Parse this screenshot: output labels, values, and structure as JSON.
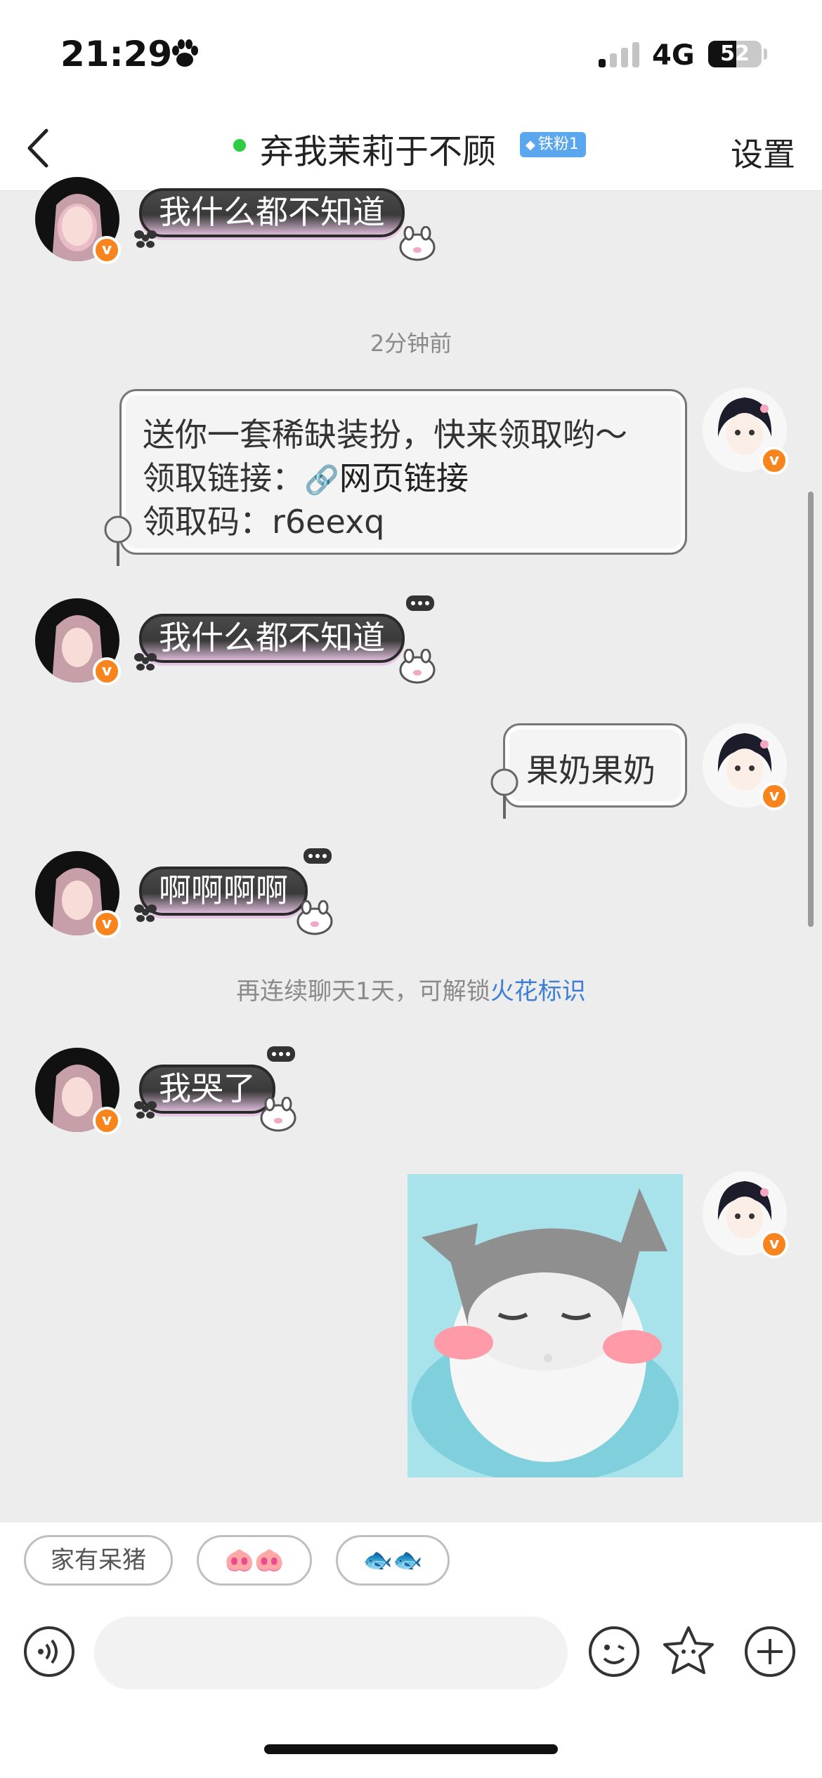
{
  "status_bar": {
    "time": "21:29",
    "network": "4G",
    "battery": "52",
    "battery_level_percent": 52
  },
  "header": {
    "title": "弃我茉莉于不顾",
    "fan_badge": "铁粉1",
    "settings_label": "设置"
  },
  "messages": [
    {
      "side": "left",
      "type": "text",
      "text": "我什么都不知道"
    },
    {
      "type": "timestamp",
      "text": "2分钟前"
    },
    {
      "side": "right",
      "type": "share",
      "line1": "送你一套稀缺装扮，快来领取哟～",
      "line2_prefix": "领取链接：",
      "link_text": "网页链接",
      "line3": "领取码：r6eexq"
    },
    {
      "side": "left",
      "type": "text",
      "text": "我什么都不知道"
    },
    {
      "side": "right",
      "type": "text",
      "text": "果奶果奶"
    },
    {
      "side": "left",
      "type": "text",
      "text": "啊啊啊啊"
    },
    {
      "type": "hint",
      "text": "再连续聊天1天，可解锁",
      "link_text": "火花标识"
    },
    {
      "side": "left",
      "type": "text",
      "text": "我哭了"
    },
    {
      "side": "right",
      "type": "image",
      "icon": "cat-sticker"
    }
  ],
  "quick_replies": [
    "家有呆猪",
    "🐽🐽",
    "🐟🐟"
  ],
  "input": {
    "placeholder": "",
    "icons": [
      "voice-icon",
      "emoji-icon",
      "sticker-icon",
      "plus-icon"
    ]
  },
  "colors": {
    "accent": "#f7841d",
    "link": "#3d7fd6",
    "online": "#2ecc40",
    "badge": "#5aa7f0"
  }
}
